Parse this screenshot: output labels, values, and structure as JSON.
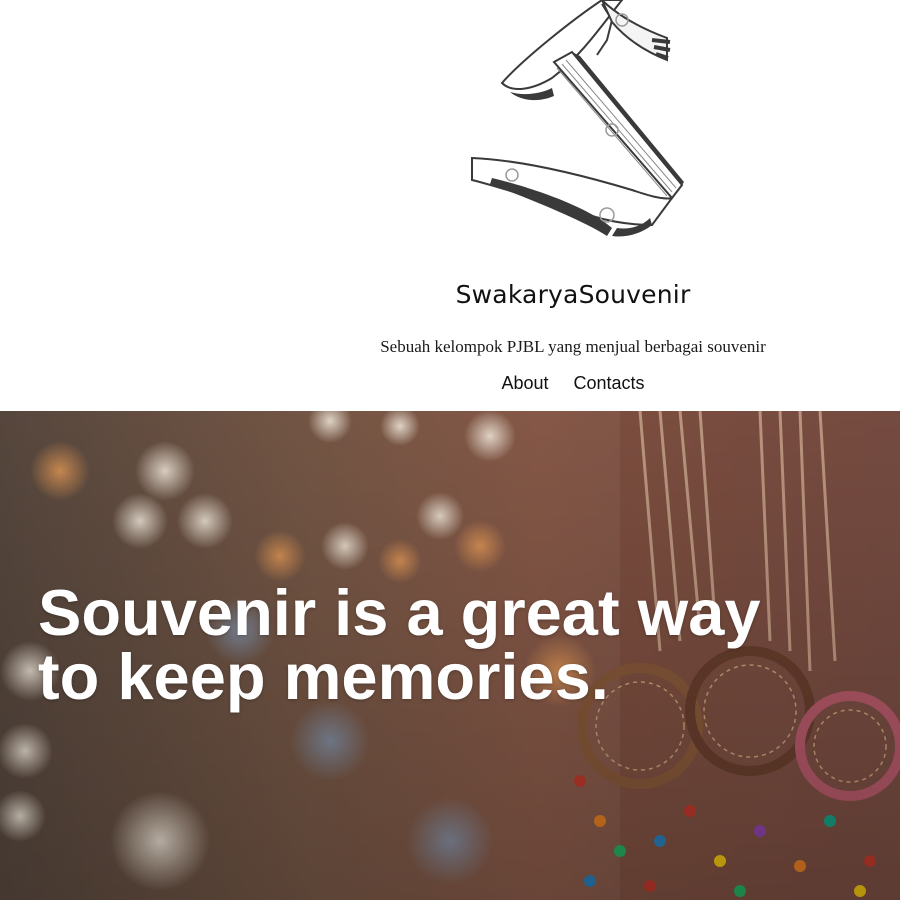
{
  "header": {
    "site_title": "SwakaryaSouvenir",
    "tagline": "Sebuah kelompok PJBL yang menjual berbagai souvenir",
    "nav": [
      {
        "label": "About"
      },
      {
        "label": "Contacts"
      }
    ]
  },
  "hero": {
    "headline_line1": "Souvenir is a great way",
    "headline_line2": "to keep memories."
  },
  "colors": {
    "header_bg": "#ffffff",
    "text": "#111111",
    "hero_text": "#ffffff",
    "logo_ink": "#3a3a3a"
  }
}
